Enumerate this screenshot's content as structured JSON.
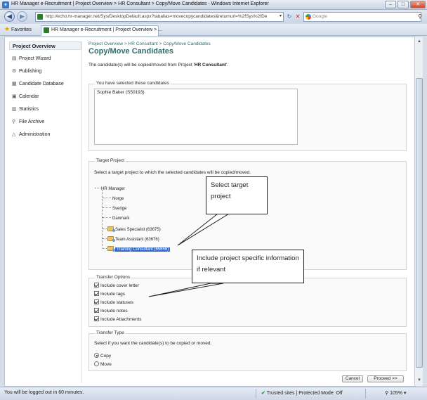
{
  "window": {
    "title": "HR Manager e-Recruitment | Project Overview > HR Consultant > Copy/Move Candidates - Windows Internet Explorer",
    "minimize": "–",
    "maximize": "□",
    "close": "✕"
  },
  "browser": {
    "address": "http://echo.hr-manager.net/Sys/DesktopDefault.aspx?tabalias=movecopycandidates&returnurl=%2fSys%2fDe",
    "search_placeholder": "Google",
    "favorites_label": "Favorites",
    "tab_label": "HR Manager e-Recruitment | Project Overview > ..."
  },
  "sidebar": {
    "heading": "Project Overview",
    "items": [
      {
        "label": "Project Wizard",
        "icon": "wizard-icon"
      },
      {
        "label": "Publishing",
        "icon": "publishing-icon"
      },
      {
        "label": "Candidate Database",
        "icon": "database-icon"
      },
      {
        "label": "Calendar",
        "icon": "calendar-icon"
      },
      {
        "label": "Statistics",
        "icon": "statistics-icon"
      },
      {
        "label": "File Archive",
        "icon": "archive-icon"
      },
      {
        "label": "Administration",
        "icon": "administration-icon"
      }
    ]
  },
  "main": {
    "breadcrumb": "Project Overview > HR Consultant > Copy/Move Candidates",
    "title": "Copy/Move Candidates",
    "info_prefix": "The candidate(s) will be copied/moved from Project '",
    "info_project": "HR Consultant",
    "info_suffix": "'.",
    "selected": {
      "legend": "You have selected these candidates",
      "candidates": [
        "Sophie Baker (S50193)"
      ]
    },
    "target": {
      "legend": "Target Project",
      "description": "Select a target project to which the selected candidates will be copied/moved.",
      "root": "HR Manager",
      "nodes": [
        "Norge",
        "Sverige",
        "Danmark",
        "Sales Specialist (63675)",
        "Team Assistant (63676)",
        "Training Consultant (65656)"
      ]
    },
    "options": {
      "legend": "Transfer Options",
      "items": [
        {
          "label": "Include cover letter",
          "checked": true
        },
        {
          "label": "Include tags",
          "checked": true
        },
        {
          "label": "Include statuses",
          "checked": true
        },
        {
          "label": "Include notes",
          "checked": true
        },
        {
          "label": "Include Attachments",
          "checked": true
        }
      ]
    },
    "type": {
      "legend": "Transfer Type",
      "description": "Select if you want the candidate(s) to be copied or moved.",
      "copy": "Copy",
      "move": "Move",
      "selected": "Copy"
    },
    "buttons": {
      "cancel": "Cancel",
      "proceed": "Proceed >>"
    }
  },
  "callouts": {
    "target": "Select target project",
    "options": "Include project specific information if relevant"
  },
  "status": {
    "message": "You will be logged out in 60 minutes.",
    "zone": "Trusted sites | Protected Mode: Off",
    "zoom": "105%"
  }
}
